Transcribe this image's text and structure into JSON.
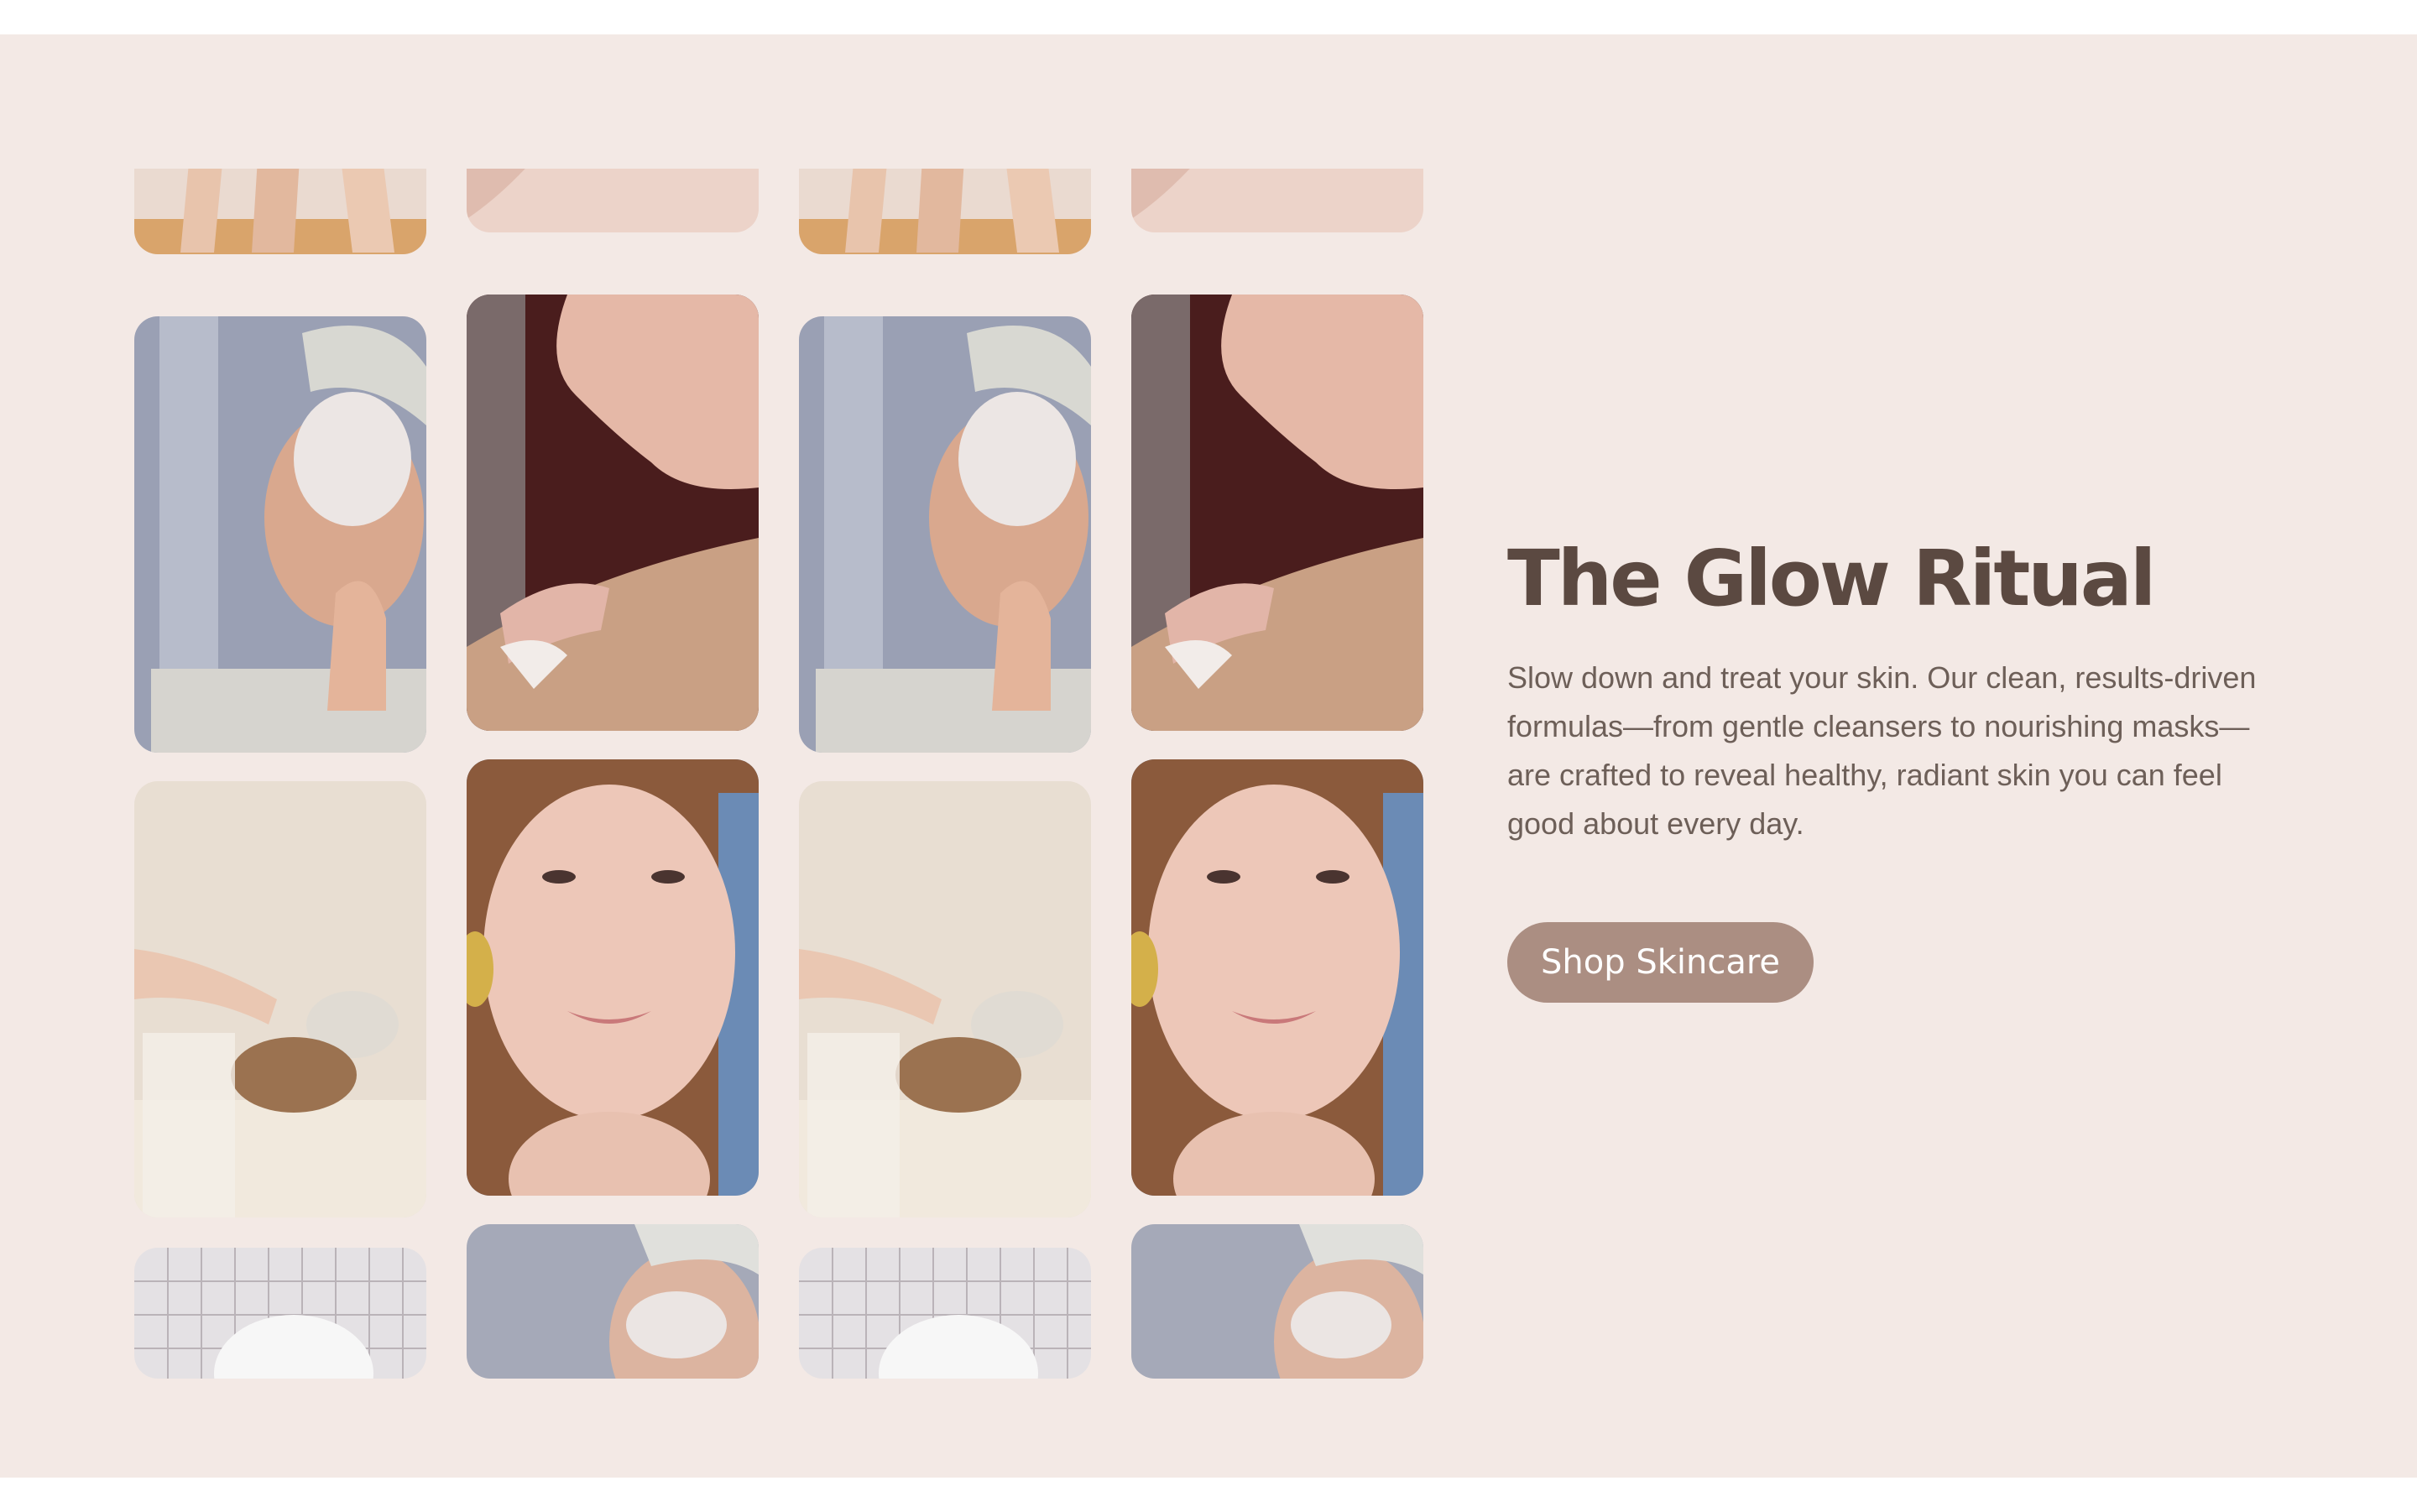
{
  "hero": {
    "title": "The Glow Ritual",
    "description": "Slow down and treat your skin. Our clean, results-driven formulas—from gentle cleansers to nourishing masks—are crafted to reveal healthy, radiant skin you can feel good about every day.",
    "cta_label": "Shop Skincare"
  },
  "gallery": {
    "photos": [
      {
        "subject": "legs-on-towel"
      },
      {
        "subject": "woman-applying-face-mask"
      },
      {
        "subject": "spa-facial-treatment"
      },
      {
        "subject": "bathroom-towel-on-head"
      },
      {
        "subject": "skin-closeup"
      },
      {
        "subject": "woman-profile-applying-cream"
      },
      {
        "subject": "smiling-woman-with-sponge"
      },
      {
        "subject": "woman-with-towel-mask"
      }
    ]
  },
  "colors": {
    "section_background": "#f3e9e5",
    "title": "#5b4941",
    "body": "#6d5f58",
    "button": "#ab8e82",
    "button_text": "#ffffff"
  }
}
